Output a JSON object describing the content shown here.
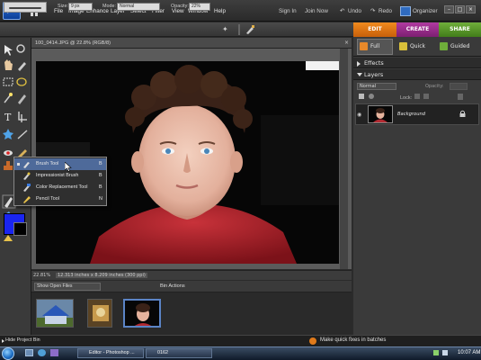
{
  "app": {
    "logo_text": "pse"
  },
  "menu": {
    "items": [
      "File",
      "Image",
      "Enhance",
      "Layer",
      "Select",
      "Filter",
      "View",
      "Window",
      "Help"
    ],
    "right": {
      "sign_in": "Sign In",
      "join_now": "Join Now",
      "undo": "Undo",
      "redo": "Redo",
      "organizer": "Organizer"
    }
  },
  "options": {
    "size_label": "Size:",
    "size_value": "9 px",
    "mode_label": "Mode:",
    "mode_value": "Normal",
    "opacity_label": "Opacity:",
    "opacity_value": "22%"
  },
  "mode_tabs": {
    "edit": "EDIT",
    "create": "CREATE",
    "share": "SHARE"
  },
  "edit_subtabs": {
    "full": "Full",
    "quick": "Quick",
    "guided": "Guided"
  },
  "document": {
    "title": "100_0414.JPG @ 22.8% (RGB/8)",
    "zoom": "22.81%",
    "dimensions": "12.313 inches x 8.209 inches (300 ppi)"
  },
  "flyout": {
    "items": [
      {
        "label": "Brush Tool",
        "key": "B"
      },
      {
        "label": "Impressionist Brush",
        "key": "B"
      },
      {
        "label": "Color Replacement Tool",
        "key": "B"
      },
      {
        "label": "Pencil Tool",
        "key": "N"
      }
    ]
  },
  "project_bin": {
    "show_select": "Show Open Files",
    "actions_label": "Bin Actions"
  },
  "panels": {
    "effects": "Effects",
    "layers": "Layers",
    "layers_mode": "Normal",
    "layers_opacity": "Opacity:",
    "lock_label": "Lock:",
    "layer_name": "Background"
  },
  "statusbar": {
    "hide_bin": "Hide Project Bin",
    "tip": "Make quick fixes in batches"
  },
  "taskbar": {
    "items": [
      "Editor - Photoshop ...",
      "0162"
    ],
    "time": "10:07 AM"
  },
  "colors": {
    "foreground": "#1a25f0",
    "background": "#000000",
    "edit_tab": "#e0781a",
    "create_tab": "#9a2e8c",
    "share_tab": "#5a9a2c"
  }
}
